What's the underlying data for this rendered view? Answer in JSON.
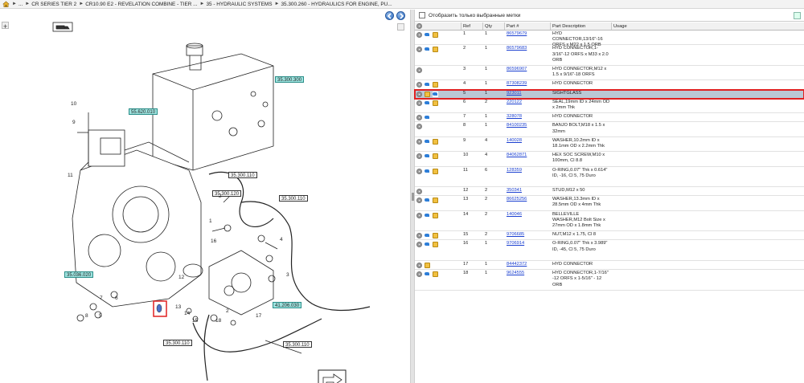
{
  "breadcrumb": {
    "home_icon": "home-icon",
    "items": [
      "...",
      "CR SERIES TIER 2",
      "CR10.90 E2 - REVELATION COMBINE - TIER ...",
      "35 - HYDRAULIC SYSTEMS",
      "35.300.260 - HYDRAULICS FOR ENGINE, PU..."
    ],
    "separator": "►"
  },
  "diagram": {
    "callouts": [
      "35.300.300",
      "55.620.010",
      "35.300.110",
      "35.300.120",
      "35.300.110",
      "35.036.020",
      "41.206.030",
      "35.300.110",
      "35.300.110"
    ],
    "numbers": [
      "10",
      "9",
      "11",
      "1",
      "16",
      "4",
      "2",
      "12",
      "3",
      "7",
      "6",
      "5",
      "8",
      "13",
      "14",
      "15",
      "2",
      "17",
      "18"
    ]
  },
  "filter": {
    "label": "Отобразить только выбранные метки",
    "checked": false
  },
  "table": {
    "headers": [
      "",
      "Ref",
      "Qty",
      "Part #",
      "Part Description",
      "Usage"
    ],
    "rows": [
      {
        "icons": [
          "info",
          "arrow",
          "box"
        ],
        "ref": "1",
        "qty": "1",
        "part": "86579679",
        "desc": "HYD CONNECTOR,13/16\"-16 ORFS x M22 x 1.5 ORB",
        "usage": ""
      },
      {
        "icons": [
          "info",
          "arrow",
          "box"
        ],
        "ref": "2",
        "qty": "1",
        "part": "86579683",
        "desc": "HYD CONNECTOR,1-3/16\"-12 ORFS x M33 x 2.0 ORB",
        "usage": ""
      },
      {
        "icons": [
          "info"
        ],
        "ref": "3",
        "qty": "1",
        "part": "86596907",
        "desc": "HYD CONNECTOR,M12 x 1.5 x 9/16\"-18 ORFS",
        "usage": ""
      },
      {
        "icons": [
          "info",
          "arrow",
          "box"
        ],
        "ref": "4",
        "qty": "1",
        "part": "87308239",
        "desc": "HYD CONNECTOR",
        "usage": ""
      },
      {
        "icons": [
          "info",
          "box",
          "arrow"
        ],
        "ref": "5",
        "qty": "1",
        "part": "923011",
        "desc": "SIGHTGLASS",
        "usage": "",
        "selected": true
      },
      {
        "icons": [
          "info",
          "arrow",
          "box"
        ],
        "ref": "6",
        "qty": "2",
        "part": "220122",
        "desc": "SEAL,19mm ID x 24mm OD x 2mm Thk",
        "usage": ""
      },
      {
        "icons": [
          "info",
          "arrow"
        ],
        "ref": "7",
        "qty": "1",
        "part": "328078",
        "desc": "HYD CONNECTOR",
        "usage": ""
      },
      {
        "icons": [
          "info"
        ],
        "ref": "8",
        "qty": "1",
        "part": "84100235",
        "desc": "BANJO BOLT,M18 x 1.5 x 32mm",
        "usage": ""
      },
      {
        "icons": [
          "info",
          "arrow",
          "box"
        ],
        "ref": "9",
        "qty": "4",
        "part": "140028",
        "desc": "WASHER,10.2mm ID x 18.1mm OD x 2.2mm Thk",
        "usage": ""
      },
      {
        "icons": [
          "info",
          "arrow",
          "box"
        ],
        "ref": "10",
        "qty": "4",
        "part": "84062871",
        "desc": "HEX SOC SCREW,M10 x 100mm, Cl 8.8",
        "usage": ""
      },
      {
        "icons": [
          "info",
          "arrow",
          "box"
        ],
        "ref": "11",
        "qty": "6",
        "part": "128359",
        "desc": "O-RING,0.07\" Thk x 0.614\" ID, -16, Cl 5, 75 Duro",
        "usage": ""
      },
      {
        "icons": [
          "info"
        ],
        "ref": "12",
        "qty": "2",
        "part": "350341",
        "desc": "STUD,M12 x 50",
        "usage": ""
      },
      {
        "icons": [
          "info",
          "arrow",
          "box"
        ],
        "ref": "13",
        "qty": "2",
        "part": "86625256",
        "desc": "WASHER,13.3mm ID x 28.5mm OD x 4mm Thk",
        "usage": ""
      },
      {
        "icons": [
          "info",
          "arrow",
          "box"
        ],
        "ref": "14",
        "qty": "2",
        "part": "140046",
        "desc": "BELLEVILLE WASHER,M12 Bolt Size x 27mm OD x 1.8mm Thk",
        "usage": ""
      },
      {
        "icons": [
          "info",
          "arrow",
          "box"
        ],
        "ref": "15",
        "qty": "2",
        "part": "9706685",
        "desc": "NUT,M12 x 1.75, Cl 8",
        "usage": ""
      },
      {
        "icons": [
          "info",
          "arrow",
          "box"
        ],
        "ref": "16",
        "qty": "1",
        "part": "9706914",
        "desc": "O-RING,0.07\" Thk x 3.989\" ID, -45, Cl 5, 75 Duro",
        "usage": ""
      },
      {
        "icons": [
          "info",
          "box"
        ],
        "ref": "17",
        "qty": "1",
        "part": "84442372",
        "desc": "HYD CONNECTOR",
        "usage": ""
      },
      {
        "icons": [
          "info",
          "arrow",
          "box"
        ],
        "ref": "18",
        "qty": "1",
        "part": "9624555",
        "desc": "HYD CONNECTOR,1-7/16\" -12 ORFS x 1-5/16\" - 12 ORB",
        "usage": ""
      }
    ]
  },
  "colors": {
    "selected_row": "#bac8d5",
    "highlight_border": "#e02020",
    "callout_teal": "#9ee4e0",
    "link": "#1a3fd0"
  }
}
